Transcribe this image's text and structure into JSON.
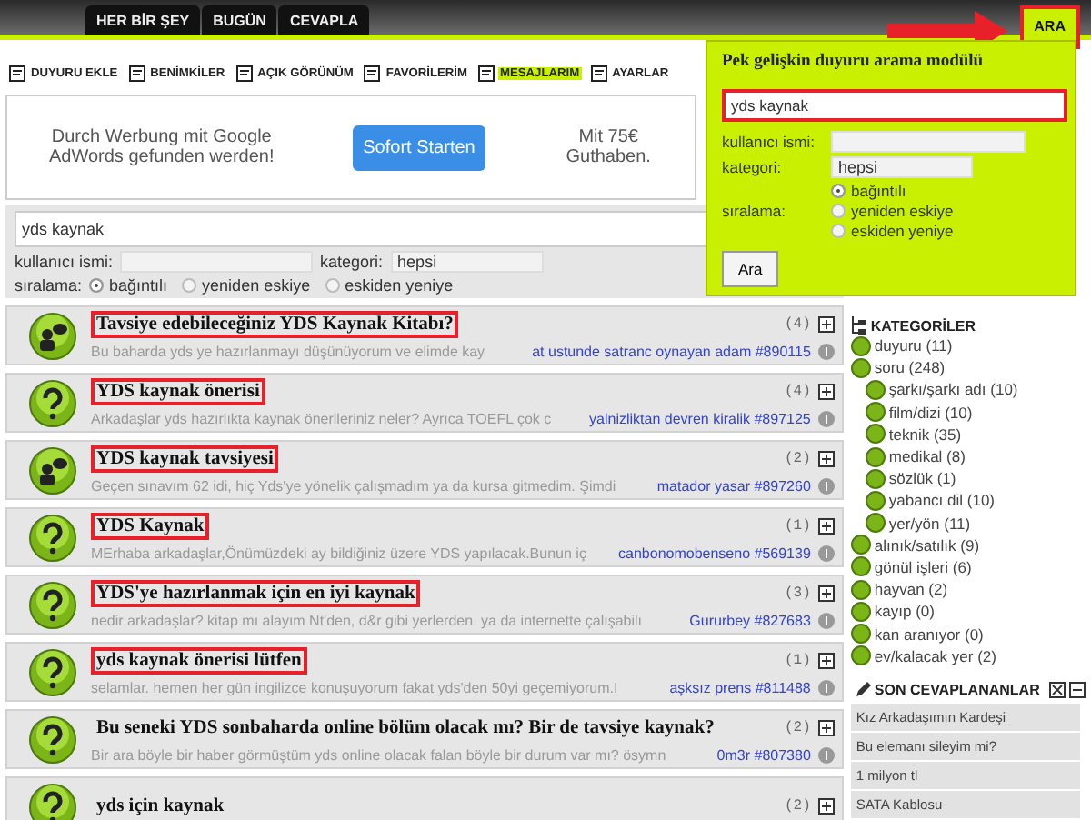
{
  "top_tabs": [
    {
      "label": "HER BİR ŞEY"
    },
    {
      "label": "BUGÜN"
    },
    {
      "label": "CEVAPLA"
    }
  ],
  "search_tab": {
    "label": "ARA",
    "annotated": true
  },
  "toolbar": [
    {
      "label": "DUYURU EKLE",
      "selected": false
    },
    {
      "label": "BENİMKİLER",
      "selected": false
    },
    {
      "label": "AÇIK GÖRÜNÜM",
      "selected": false
    },
    {
      "label": "FAVORİLERİM",
      "selected": false
    },
    {
      "label": "MESAJLARIM",
      "selected": true
    },
    {
      "label": "AYARLAR",
      "selected": false
    }
  ],
  "ad": {
    "text": "Durch Werbung mit Google AdWords gefunden werden!",
    "button": "Sofort Starten",
    "offer": "Mit 75€ Guthaben."
  },
  "search": {
    "query": "yds kaynak",
    "user_label": "kullanıcı ismi:",
    "category_label": "kategori:",
    "category": "hepsi",
    "sort_label": "sıralama:",
    "sort_options": [
      {
        "label": "bağıntılı",
        "selected": true
      },
      {
        "label": "yeniden eskiye",
        "selected": false
      },
      {
        "label": "eskiden yeniye",
        "selected": false
      }
    ]
  },
  "popup": {
    "title": "Pek gelişkin duyuru arama modülü",
    "query": "yds kaynak",
    "query_annotated": true,
    "user_label": "kullanıcı ismi:",
    "category_label": "kategori:",
    "category": "hepsi",
    "sort_label": "sıralama:",
    "sort_options": [
      {
        "label": "bağıntılı",
        "selected": true
      },
      {
        "label": "yeniden eskiye",
        "selected": false
      },
      {
        "label": "eskiden yeniye",
        "selected": false
      }
    ],
    "button": "Ara"
  },
  "posts": [
    {
      "kind": "chat",
      "title": "Tavsiye edebileceğiniz YDS Kaynak Kitabı?",
      "marked": true,
      "snippet": "Bu baharda yds ye hazırlanmayı düşünüyorum ve elimde kay",
      "author": "at ustunde satranc oynayan adam #890115",
      "count": "(4)"
    },
    {
      "kind": "question",
      "title": "YDS kaynak önerisi",
      "marked": true,
      "snippet": "Arkadaşlar yds hazırlıkta kaynak önerileriniz neler? Ayrıca TOEFL çok c",
      "author": "yalnizliktan devren kiralik #897125",
      "count": "(4)"
    },
    {
      "kind": "chat",
      "title": "YDS kaynak tavsiyesi",
      "marked": true,
      "snippet": "Geçen sınavım 62 idi, hiç Yds'ye yönelik çalışmadım ya da kursa gitmedim. Şimdi",
      "author": "matador yasar #897260",
      "count": "(2)"
    },
    {
      "kind": "question",
      "title": "YDS Kaynak",
      "marked": true,
      "snippet": "MErhaba arkadaşlar,Önümüzdeki ay bildiğiniz üzere YDS yapılacak.Bunun iç",
      "author": "canbonomobenseno #569139",
      "count": "(1)"
    },
    {
      "kind": "question",
      "title": "YDS'ye hazırlanmak için en iyi kaynak",
      "marked": true,
      "snippet": "nedir arkadaşlar? kitap mı alayım Nt'den, d&r gibi yerlerden. ya da internette çalışabilı",
      "author": "Gururbey #827683",
      "count": "(3)"
    },
    {
      "kind": "question",
      "title": "yds kaynak önerisi lütfen",
      "marked": true,
      "snippet": "selamlar. hemen her gün ingilizce konuşuyorum fakat yds'den 50yi geçemiyorum.I",
      "author": "aşksız prens #811488",
      "count": "(1)"
    },
    {
      "kind": "question",
      "title": "Bu seneki YDS sonbaharda online bölüm olacak mı? Bir de tavsiye kaynak?",
      "marked": false,
      "snippet": "Bir ara böyle bir haber görmüştüm yds online olacak falan böyle bir durum var mı? ösymn",
      "author": "0m3r #807380",
      "count": "(2)"
    },
    {
      "kind": "question",
      "title": "yds için kaynak",
      "marked": false,
      "count": "(2)"
    }
  ],
  "categories_title": "KATEGORİLER",
  "categories": [
    {
      "label": "duyuru (11)"
    },
    {
      "label": "soru (248)",
      "children": [
        {
          "label": "şarkı/şarkı adı (10)"
        },
        {
          "label": "film/dizi (10)"
        },
        {
          "label": "teknik (35)"
        },
        {
          "label": "medikal (8)"
        },
        {
          "label": "sözlük (1)"
        },
        {
          "label": "yabancı dil (10)"
        },
        {
          "label": "yer/yön (11)"
        }
      ]
    },
    {
      "label": "alınık/satılık (9)"
    },
    {
      "label": "gönül işleri (6)"
    },
    {
      "label": "hayvan (2)"
    },
    {
      "label": "kayıp (0)"
    },
    {
      "label": "kan aranıyor (0)"
    },
    {
      "label": "ev/kalacak yer (2)"
    }
  ],
  "recent_title": "SON CEVAPLANANLAR",
  "recent": [
    "Kız Arkadaşımın Kardeşi",
    "Bu elemanı sileyim mi?",
    "1 milyon tl",
    "SATA Kablosu"
  ]
}
